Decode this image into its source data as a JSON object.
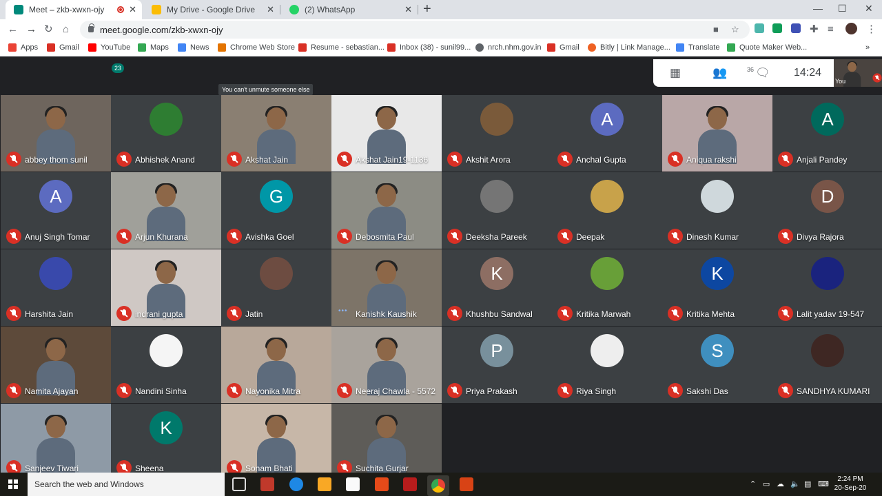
{
  "browser": {
    "tabs": [
      {
        "label": "Meet – zkb-xwxn-ojy",
        "icon": "meet-icon",
        "color": "#00897b",
        "recording": true
      },
      {
        "label": "My Drive - Google Drive",
        "icon": "drive-icon",
        "color": "#fbbc04"
      },
      {
        "label": "(2) WhatsApp",
        "icon": "whatsapp-icon",
        "color": "#25d366"
      }
    ],
    "new_tab": "+",
    "url": "meet.google.com/zkb-xwxn-ojy",
    "bookmarks": [
      {
        "label": "Apps",
        "color": "#ea4335"
      },
      {
        "label": "Gmail",
        "color": "#d93025"
      },
      {
        "label": "YouTube",
        "color": "#ff0000"
      },
      {
        "label": "Maps",
        "color": "#34a853"
      },
      {
        "label": "News",
        "color": "#4285f4"
      },
      {
        "label": "Chrome Web Store",
        "color": "#e37400"
      },
      {
        "label": "Resume - sebastian...",
        "color": "#d93025"
      },
      {
        "label": "Inbox (38) - sunil99...",
        "color": "#d93025"
      },
      {
        "label": "nrch.nhm.gov.in",
        "color": "#5f6368"
      },
      {
        "label": "Gmail",
        "color": "#d93025"
      },
      {
        "label": "Bitly | Link Manage...",
        "color": "#ee6123"
      },
      {
        "label": "Translate",
        "color": "#4285f4"
      },
      {
        "label": "Quote Maker Web...",
        "color": "#34a853"
      }
    ]
  },
  "meet": {
    "participant_count": "36",
    "chat_count": "23",
    "time": "14:24",
    "self_label": "You",
    "tooltip": "You can't unmute someone else",
    "participants": [
      {
        "name": "abbey thom sunil",
        "type": "video",
        "bg": "#6e655d"
      },
      {
        "name": "Abhishek Anand",
        "type": "avatar",
        "bg": "#2e7d32"
      },
      {
        "name": "Akshat Jain",
        "type": "video",
        "bg": "#8a7f72"
      },
      {
        "name": "Akshat Jain19-1136",
        "type": "video",
        "bg": "#e8e8e8"
      },
      {
        "name": "Akshit Arora",
        "type": "avatar",
        "bg": "#7a5a3a"
      },
      {
        "name": "Anchal Gupta",
        "type": "letter",
        "letter": "A",
        "bg": "#5c6bc0"
      },
      {
        "name": "Aniqua rakshi",
        "type": "video",
        "bg": "#b9a7a7"
      },
      {
        "name": "Anjali Pandey",
        "type": "letter",
        "letter": "A",
        "bg": "#00695c"
      },
      {
        "name": "Anuj Singh Tomar",
        "type": "letter",
        "letter": "A",
        "bg": "#5c6bc0"
      },
      {
        "name": "Arjun Khurana",
        "type": "video",
        "bg": "#a0a09a"
      },
      {
        "name": "Avishka Goel",
        "type": "letter",
        "letter": "G",
        "bg": "#0097a7"
      },
      {
        "name": "Debosmita Paul",
        "type": "video",
        "bg": "#8c8c84"
      },
      {
        "name": "Deeksha Pareek",
        "type": "avatar",
        "bg": "#757575"
      },
      {
        "name": "Deepak",
        "type": "avatar",
        "bg": "#c8a24a"
      },
      {
        "name": "Dinesh Kumar",
        "type": "avatar",
        "bg": "#cfd8dc"
      },
      {
        "name": "Divya Rajora",
        "type": "letter",
        "letter": "D",
        "bg": "#795548"
      },
      {
        "name": "Harshita Jain",
        "type": "avatar",
        "bg": "#3949ab"
      },
      {
        "name": "indrani gupta",
        "type": "video",
        "bg": "#cfc8c4"
      },
      {
        "name": "Jatin",
        "type": "avatar",
        "bg": "#6d4c41"
      },
      {
        "name": "Kanishk Kaushik",
        "type": "video",
        "bg": "#7d7468"
      },
      {
        "name": "Khushbu Sandwal",
        "type": "letter",
        "letter": "K",
        "bg": "#8d6e63"
      },
      {
        "name": "Kritika Marwah",
        "type": "avatar",
        "bg": "#689f38"
      },
      {
        "name": "Kritika Mehta",
        "type": "letter",
        "letter": "K",
        "bg": "#0d47a1"
      },
      {
        "name": "Lalit yadav 19-547",
        "type": "avatar",
        "bg": "#1a237e"
      },
      {
        "name": "Namita Ajayan",
        "type": "video",
        "bg": "#5d4a3a"
      },
      {
        "name": "Nandini Sinha",
        "type": "avatar",
        "bg": "#f5f5f5"
      },
      {
        "name": "Nayonika Mitra",
        "type": "video",
        "bg": "#b8a89a"
      },
      {
        "name": "Neeraj Chawla - 5572",
        "type": "video",
        "bg": "#a9a39c"
      },
      {
        "name": "Priya Prakash",
        "type": "letter",
        "letter": "P",
        "bg": "#78909c"
      },
      {
        "name": "Riya Singh",
        "type": "avatar",
        "bg": "#eeeeee"
      },
      {
        "name": "Sakshi Das",
        "type": "letter",
        "letter": "S",
        "bg": "#3f8fbf"
      },
      {
        "name": "SANDHYA KUMARI",
        "type": "avatar",
        "bg": "#3e2723"
      },
      {
        "name": "Sanjeev Tiwari",
        "type": "video",
        "bg": "#8e9aa6"
      },
      {
        "name": "Sheena",
        "type": "letter",
        "letter": "K",
        "bg": "#00796b"
      },
      {
        "name": "Sonam Bhati",
        "type": "video",
        "bg": "#c7b7a8"
      },
      {
        "name": "Suchita Gurjar",
        "type": "video",
        "bg": "#5e5c58"
      }
    ]
  },
  "taskbar": {
    "search_placeholder": "Search the web and Windows",
    "time": "2:24 PM",
    "date": "20-Sep-20"
  }
}
